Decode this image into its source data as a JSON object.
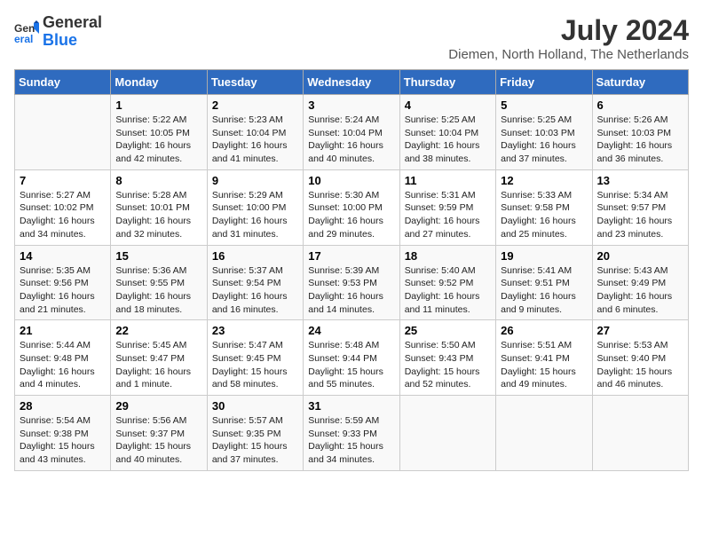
{
  "header": {
    "logo_general": "General",
    "logo_blue": "Blue",
    "month_title": "July 2024",
    "location": "Diemen, North Holland, The Netherlands"
  },
  "weekdays": [
    "Sunday",
    "Monday",
    "Tuesday",
    "Wednesday",
    "Thursday",
    "Friday",
    "Saturday"
  ],
  "weeks": [
    [
      {
        "day": "",
        "info": ""
      },
      {
        "day": "1",
        "info": "Sunrise: 5:22 AM\nSunset: 10:05 PM\nDaylight: 16 hours\nand 42 minutes."
      },
      {
        "day": "2",
        "info": "Sunrise: 5:23 AM\nSunset: 10:04 PM\nDaylight: 16 hours\nand 41 minutes."
      },
      {
        "day": "3",
        "info": "Sunrise: 5:24 AM\nSunset: 10:04 PM\nDaylight: 16 hours\nand 40 minutes."
      },
      {
        "day": "4",
        "info": "Sunrise: 5:25 AM\nSunset: 10:04 PM\nDaylight: 16 hours\nand 38 minutes."
      },
      {
        "day": "5",
        "info": "Sunrise: 5:25 AM\nSunset: 10:03 PM\nDaylight: 16 hours\nand 37 minutes."
      },
      {
        "day": "6",
        "info": "Sunrise: 5:26 AM\nSunset: 10:03 PM\nDaylight: 16 hours\nand 36 minutes."
      }
    ],
    [
      {
        "day": "7",
        "info": "Sunrise: 5:27 AM\nSunset: 10:02 PM\nDaylight: 16 hours\nand 34 minutes."
      },
      {
        "day": "8",
        "info": "Sunrise: 5:28 AM\nSunset: 10:01 PM\nDaylight: 16 hours\nand 32 minutes."
      },
      {
        "day": "9",
        "info": "Sunrise: 5:29 AM\nSunset: 10:00 PM\nDaylight: 16 hours\nand 31 minutes."
      },
      {
        "day": "10",
        "info": "Sunrise: 5:30 AM\nSunset: 10:00 PM\nDaylight: 16 hours\nand 29 minutes."
      },
      {
        "day": "11",
        "info": "Sunrise: 5:31 AM\nSunset: 9:59 PM\nDaylight: 16 hours\nand 27 minutes."
      },
      {
        "day": "12",
        "info": "Sunrise: 5:33 AM\nSunset: 9:58 PM\nDaylight: 16 hours\nand 25 minutes."
      },
      {
        "day": "13",
        "info": "Sunrise: 5:34 AM\nSunset: 9:57 PM\nDaylight: 16 hours\nand 23 minutes."
      }
    ],
    [
      {
        "day": "14",
        "info": "Sunrise: 5:35 AM\nSunset: 9:56 PM\nDaylight: 16 hours\nand 21 minutes."
      },
      {
        "day": "15",
        "info": "Sunrise: 5:36 AM\nSunset: 9:55 PM\nDaylight: 16 hours\nand 18 minutes."
      },
      {
        "day": "16",
        "info": "Sunrise: 5:37 AM\nSunset: 9:54 PM\nDaylight: 16 hours\nand 16 minutes."
      },
      {
        "day": "17",
        "info": "Sunrise: 5:39 AM\nSunset: 9:53 PM\nDaylight: 16 hours\nand 14 minutes."
      },
      {
        "day": "18",
        "info": "Sunrise: 5:40 AM\nSunset: 9:52 PM\nDaylight: 16 hours\nand 11 minutes."
      },
      {
        "day": "19",
        "info": "Sunrise: 5:41 AM\nSunset: 9:51 PM\nDaylight: 16 hours\nand 9 minutes."
      },
      {
        "day": "20",
        "info": "Sunrise: 5:43 AM\nSunset: 9:49 PM\nDaylight: 16 hours\nand 6 minutes."
      }
    ],
    [
      {
        "day": "21",
        "info": "Sunrise: 5:44 AM\nSunset: 9:48 PM\nDaylight: 16 hours\nand 4 minutes."
      },
      {
        "day": "22",
        "info": "Sunrise: 5:45 AM\nSunset: 9:47 PM\nDaylight: 16 hours\nand 1 minute."
      },
      {
        "day": "23",
        "info": "Sunrise: 5:47 AM\nSunset: 9:45 PM\nDaylight: 15 hours\nand 58 minutes."
      },
      {
        "day": "24",
        "info": "Sunrise: 5:48 AM\nSunset: 9:44 PM\nDaylight: 15 hours\nand 55 minutes."
      },
      {
        "day": "25",
        "info": "Sunrise: 5:50 AM\nSunset: 9:43 PM\nDaylight: 15 hours\nand 52 minutes."
      },
      {
        "day": "26",
        "info": "Sunrise: 5:51 AM\nSunset: 9:41 PM\nDaylight: 15 hours\nand 49 minutes."
      },
      {
        "day": "27",
        "info": "Sunrise: 5:53 AM\nSunset: 9:40 PM\nDaylight: 15 hours\nand 46 minutes."
      }
    ],
    [
      {
        "day": "28",
        "info": "Sunrise: 5:54 AM\nSunset: 9:38 PM\nDaylight: 15 hours\nand 43 minutes."
      },
      {
        "day": "29",
        "info": "Sunrise: 5:56 AM\nSunset: 9:37 PM\nDaylight: 15 hours\nand 40 minutes."
      },
      {
        "day": "30",
        "info": "Sunrise: 5:57 AM\nSunset: 9:35 PM\nDaylight: 15 hours\nand 37 minutes."
      },
      {
        "day": "31",
        "info": "Sunrise: 5:59 AM\nSunset: 9:33 PM\nDaylight: 15 hours\nand 34 minutes."
      },
      {
        "day": "",
        "info": ""
      },
      {
        "day": "",
        "info": ""
      },
      {
        "day": "",
        "info": ""
      }
    ]
  ]
}
